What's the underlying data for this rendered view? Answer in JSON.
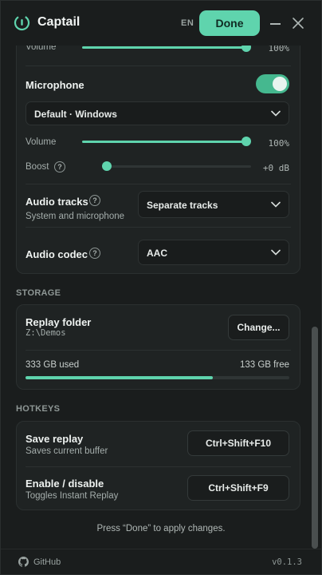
{
  "app": {
    "title": "Captail",
    "language": "EN",
    "done_label": "Done"
  },
  "audio": {
    "top_volume": {
      "label": "Volume",
      "value_text": "100%",
      "level": 1.0
    },
    "microphone": {
      "label": "Microphone",
      "enabled": true,
      "device": "Default · Windows",
      "volume": {
        "label": "Volume",
        "value_text": "100%",
        "level": 1.0
      },
      "boost": {
        "label": "Boost",
        "value_text": "+0 dB",
        "level": 0.0
      }
    },
    "tracks": {
      "label": "Audio tracks",
      "sublabel": "System and microphone",
      "value": "Separate tracks"
    },
    "codec": {
      "label": "Audio codec",
      "value": "AAC"
    }
  },
  "storage": {
    "section_title": "STORAGE",
    "folder_label": "Replay folder",
    "folder_path": "Z:\\Demos",
    "change_label": "Change...",
    "used_text": "333 GB used",
    "free_text": "133 GB free",
    "usage_fraction": 0.71
  },
  "hotkeys": {
    "section_title": "HOTKEYS",
    "items": [
      {
        "label": "Save replay",
        "sublabel": "Saves current buffer",
        "key": "Ctrl+Shift+F10"
      },
      {
        "label": "Enable / disable",
        "sublabel": "Toggles Instant Replay",
        "key": "Ctrl+Shift+F9"
      }
    ]
  },
  "hint": "Press “Done” to apply changes.",
  "footer": {
    "github_label": "GitHub",
    "version": "v0.1.3"
  },
  "colors": {
    "accent": "#5fd4ad",
    "background": "#1a1d1d",
    "card": "#1f2323"
  }
}
